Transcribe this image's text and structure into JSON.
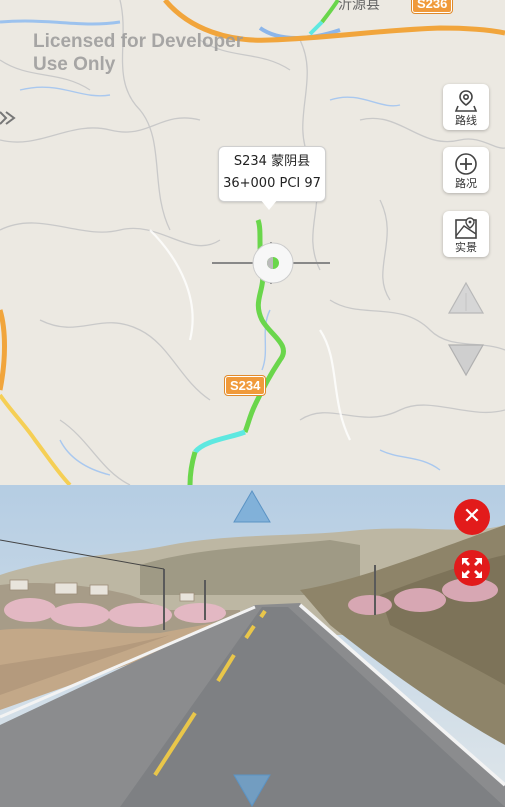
{
  "map": {
    "watermark_line1": "Licensed for Developer",
    "watermark_line2": "Use Only",
    "place_label": "沂源县",
    "shield_s234": "S234",
    "shield_s236": "S236"
  },
  "popup": {
    "line1": "S234 蒙阴县",
    "line2": "36+000 PCI 97"
  },
  "controls": {
    "route_label": "路线",
    "traffic_label": "路况",
    "street_view_label": "实景"
  },
  "icons": {
    "route": "route-map-icon",
    "traffic": "add-traffic-icon",
    "street_view": "street-view-icon",
    "close": "close-icon",
    "expand": "expand-icon"
  },
  "colors": {
    "route_green": "#6ad64b",
    "route_cyan": "#5ee8e0",
    "close_red": "#e21b1b",
    "highway_orange": "#f09a3b"
  }
}
